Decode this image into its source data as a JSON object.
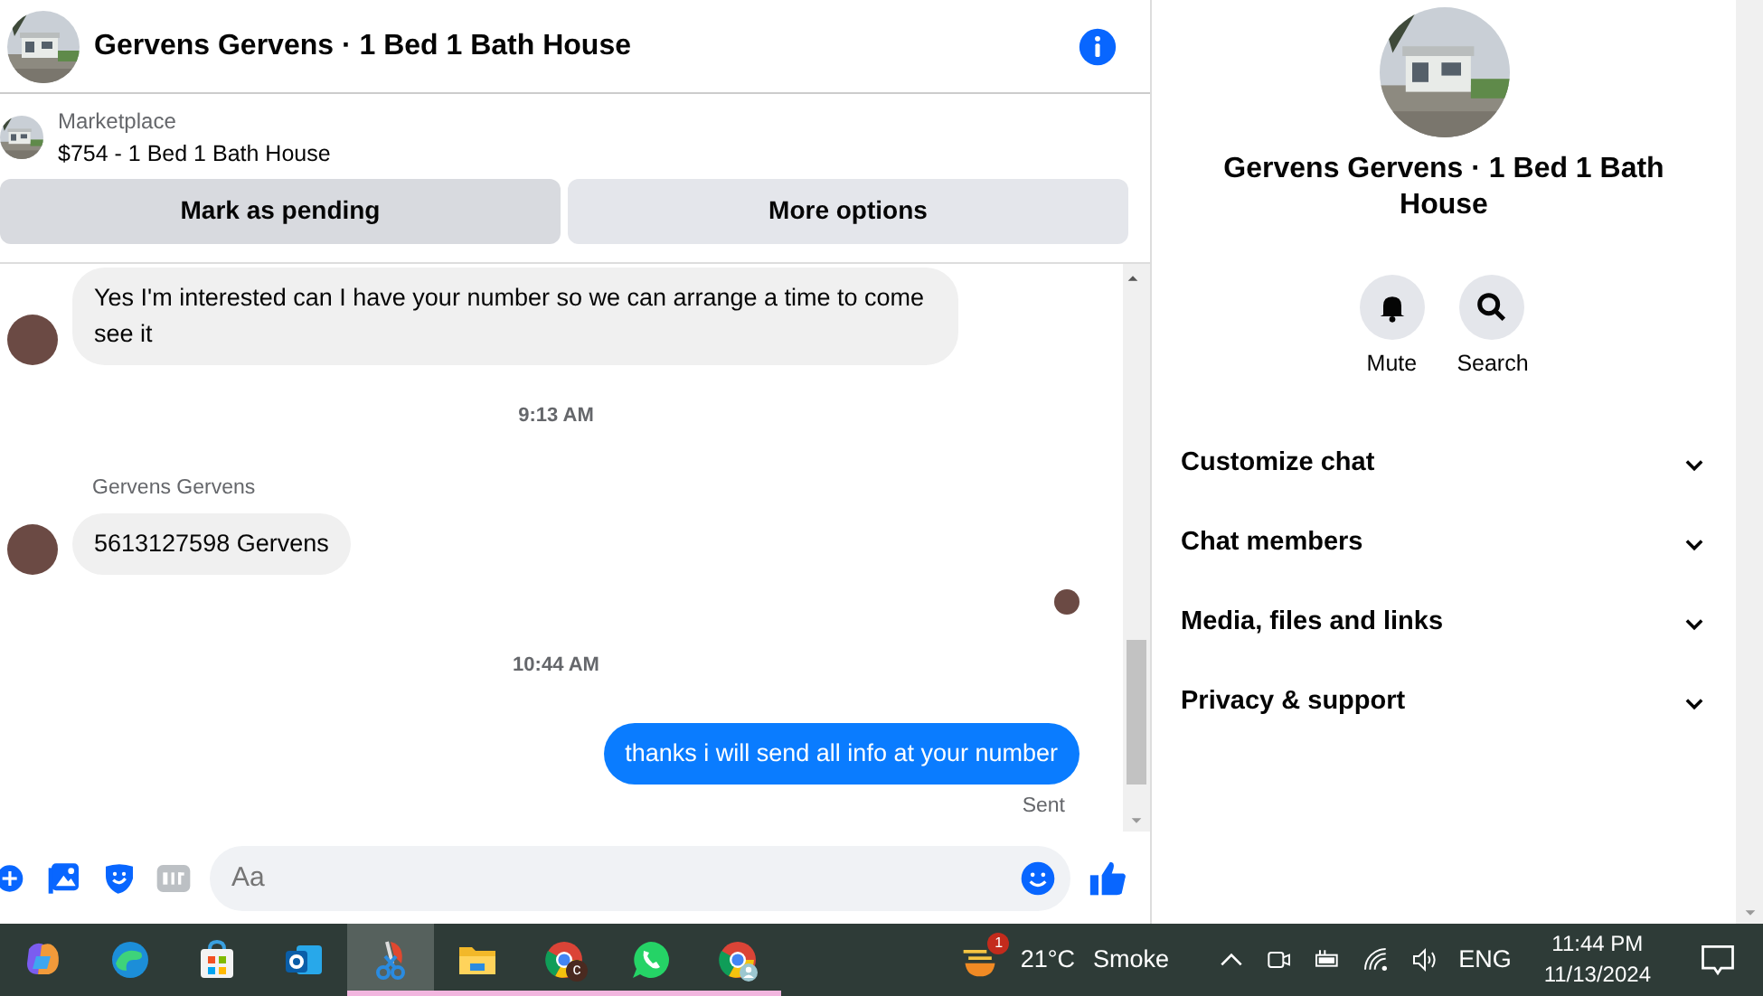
{
  "header": {
    "title": "Gervens Gervens · 1 Bed 1 Bath House"
  },
  "listing": {
    "source": "Marketplace",
    "summary": "$754 - 1 Bed 1 Bath House"
  },
  "actions": [
    {
      "label": "Mark as pending",
      "selected": true
    },
    {
      "label": "More options",
      "selected": false
    }
  ],
  "messages": [
    {
      "kind": "incoming",
      "text": "Yes I'm interested can I have your number so we can arrange a time to come see it"
    },
    {
      "kind": "timestamp",
      "text": "9:13 AM"
    },
    {
      "kind": "sender",
      "text": "Gervens Gervens"
    },
    {
      "kind": "incoming",
      "text": "5613127598 Gervens"
    },
    {
      "kind": "seen"
    },
    {
      "kind": "timestamp",
      "text": "10:44 AM"
    },
    {
      "kind": "outgoing",
      "text": "thanks i will send all info at your number"
    },
    {
      "kind": "status",
      "text": "Sent"
    }
  ],
  "composer": {
    "placeholder": "Aa"
  },
  "profile": {
    "title": "Gervens Gervens · 1 Bed 1 Bath House",
    "actions": [
      {
        "kind": "mute",
        "label": "Mute"
      },
      {
        "kind": "search",
        "label": "Search"
      }
    ],
    "sections": [
      {
        "label": "Customize chat",
        "expanded": false
      },
      {
        "label": "Chat members",
        "expanded": false
      },
      {
        "label": "Media, files and links",
        "expanded": false
      },
      {
        "label": "Privacy & support",
        "expanded": false
      }
    ]
  },
  "taskbar": {
    "apps": [
      {
        "kind": "swirl",
        "running": false,
        "selected": false
      },
      {
        "kind": "wave",
        "running": false,
        "selected": false
      },
      {
        "kind": "bag",
        "running": false,
        "selected": false
      },
      {
        "kind": "mail",
        "running": false,
        "selected": false
      },
      {
        "kind": "scissors",
        "running": true,
        "selected": true
      },
      {
        "kind": "folder",
        "running": true,
        "selected": false
      },
      {
        "kind": "browser",
        "badge": "c",
        "running": true,
        "selected": false
      },
      {
        "kind": "phone",
        "running": true,
        "selected": false
      },
      {
        "kind": "profile_browser",
        "running": true,
        "selected": false
      }
    ],
    "weather": {
      "badge": "1",
      "temperature": "21°C",
      "condition": "Smoke"
    },
    "language": "ENG",
    "time": "11:44 PM",
    "date": "11/13/2024"
  }
}
